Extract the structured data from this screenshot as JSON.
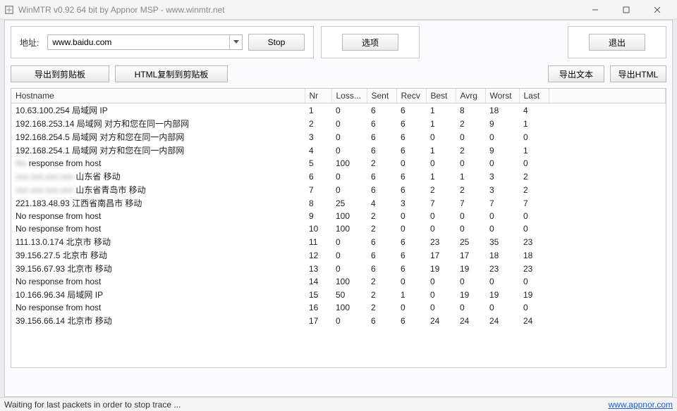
{
  "window": {
    "title": "WinMTR v0.92 64 bit by Appnor MSP - www.winmtr.net"
  },
  "address": {
    "label": "地址:",
    "value": "www.baidu.com",
    "action_button": "Stop"
  },
  "buttons": {
    "options": "选项",
    "exit": "退出",
    "export_clipboard": "导出到剪贴板",
    "html_copy_clipboard": "HTML复制到剪贴板",
    "export_text": "导出文本",
    "export_html": "导出HTML"
  },
  "table": {
    "headers": {
      "hostname": "Hostname",
      "nr": "Nr",
      "loss": "Loss...",
      "sent": "Sent",
      "recv": "Recv",
      "best": "Best",
      "avrg": "Avrg",
      "worst": "Worst",
      "last": "Last"
    },
    "rows": [
      {
        "host": "10.63.100.254 局域网 IP",
        "nr": "1",
        "loss": "0",
        "sent": "6",
        "recv": "6",
        "best": "1",
        "avrg": "8",
        "worst": "18",
        "last": "4"
      },
      {
        "host": "192.168.253.14 局域网 对方和您在同一内部网",
        "nr": "2",
        "loss": "0",
        "sent": "6",
        "recv": "6",
        "best": "1",
        "avrg": "2",
        "worst": "9",
        "last": "1"
      },
      {
        "host": "192.168.254.5 局域网 对方和您在同一内部网",
        "nr": "3",
        "loss": "0",
        "sent": "6",
        "recv": "6",
        "best": "0",
        "avrg": "0",
        "worst": "0",
        "last": "0"
      },
      {
        "host": "192.168.254.1 局域网 对方和您在同一内部网",
        "nr": "4",
        "loss": "0",
        "sent": "6",
        "recv": "6",
        "best": "1",
        "avrg": "2",
        "worst": "9",
        "last": "1"
      },
      {
        "host": "No response from host",
        "nr": "5",
        "loss": "100",
        "sent": "2",
        "recv": "0",
        "best": "0",
        "avrg": "0",
        "worst": "0",
        "last": "0",
        "blur": true
      },
      {
        "host": "xxx.xxx.xxx.xxx 山东省 移动",
        "nr": "6",
        "loss": "0",
        "sent": "6",
        "recv": "6",
        "best": "1",
        "avrg": "1",
        "worst": "3",
        "last": "2",
        "blur": true
      },
      {
        "host": "xxx.xxx.xxx.xxx 山东省青岛市 移动",
        "nr": "7",
        "loss": "0",
        "sent": "6",
        "recv": "6",
        "best": "2",
        "avrg": "2",
        "worst": "3",
        "last": "2",
        "blur": true
      },
      {
        "host": "221.183.48.93 江西省南昌市 移动",
        "nr": "8",
        "loss": "25",
        "sent": "4",
        "recv": "3",
        "best": "7",
        "avrg": "7",
        "worst": "7",
        "last": "7"
      },
      {
        "host": "No response from host",
        "nr": "9",
        "loss": "100",
        "sent": "2",
        "recv": "0",
        "best": "0",
        "avrg": "0",
        "worst": "0",
        "last": "0"
      },
      {
        "host": "No response from host",
        "nr": "10",
        "loss": "100",
        "sent": "2",
        "recv": "0",
        "best": "0",
        "avrg": "0",
        "worst": "0",
        "last": "0"
      },
      {
        "host": "111.13.0.174 北京市 移动",
        "nr": "11",
        "loss": "0",
        "sent": "6",
        "recv": "6",
        "best": "23",
        "avrg": "25",
        "worst": "35",
        "last": "23"
      },
      {
        "host": "39.156.27.5 北京市 移动",
        "nr": "12",
        "loss": "0",
        "sent": "6",
        "recv": "6",
        "best": "17",
        "avrg": "17",
        "worst": "18",
        "last": "18"
      },
      {
        "host": "39.156.67.93 北京市 移动",
        "nr": "13",
        "loss": "0",
        "sent": "6",
        "recv": "6",
        "best": "19",
        "avrg": "19",
        "worst": "23",
        "last": "23"
      },
      {
        "host": "No response from host",
        "nr": "14",
        "loss": "100",
        "sent": "2",
        "recv": "0",
        "best": "0",
        "avrg": "0",
        "worst": "0",
        "last": "0"
      },
      {
        "host": "10.166.96.34 局域网 IP",
        "nr": "15",
        "loss": "50",
        "sent": "2",
        "recv": "1",
        "best": "0",
        "avrg": "19",
        "worst": "19",
        "last": "19"
      },
      {
        "host": "No response from host",
        "nr": "16",
        "loss": "100",
        "sent": "2",
        "recv": "0",
        "best": "0",
        "avrg": "0",
        "worst": "0",
        "last": "0"
      },
      {
        "host": "39.156.66.14 北京市 移动",
        "nr": "17",
        "loss": "0",
        "sent": "6",
        "recv": "6",
        "best": "24",
        "avrg": "24",
        "worst": "24",
        "last": "24"
      }
    ]
  },
  "status": {
    "text": "Waiting for last packets in order to stop trace ...",
    "link": "www.appnor.com"
  }
}
